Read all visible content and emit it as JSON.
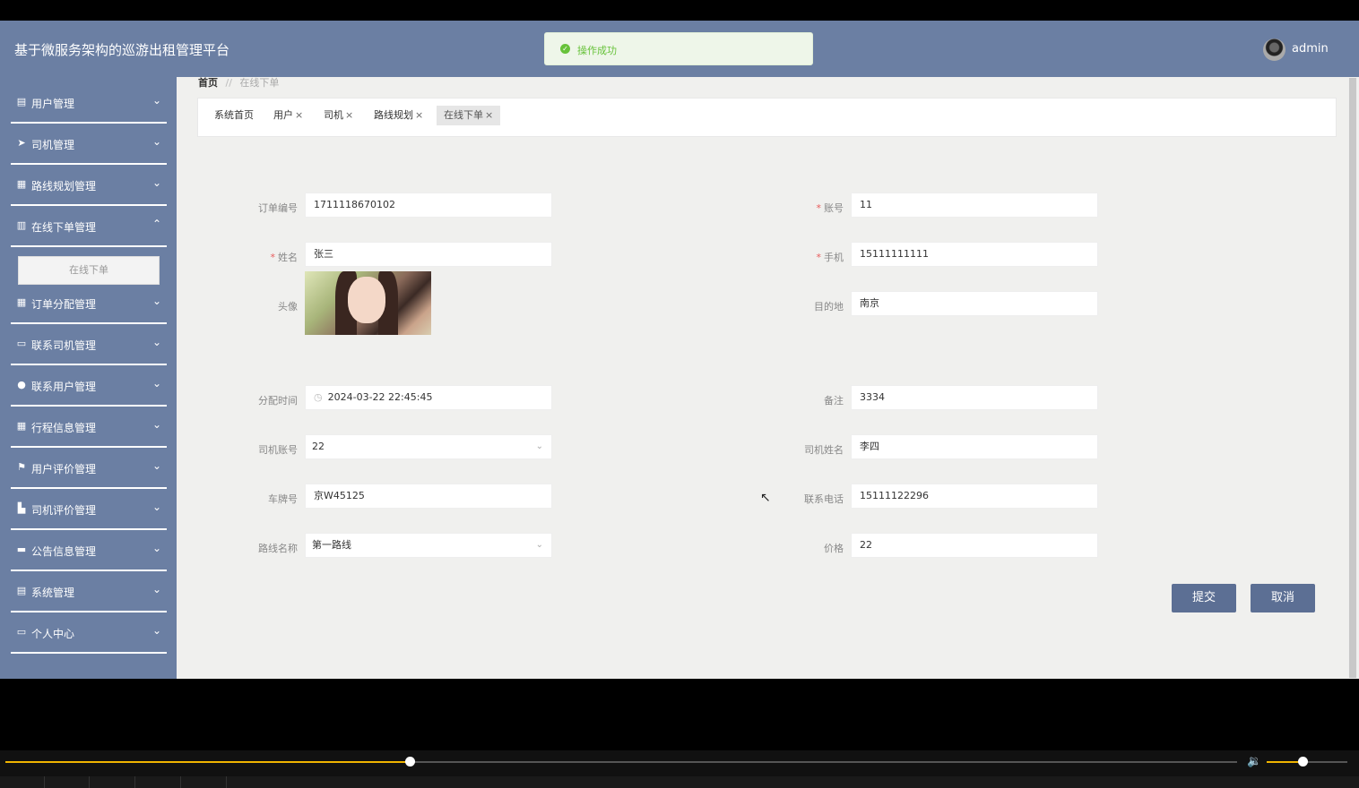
{
  "app": {
    "title": "基于微服务架构的巡游出租管理平台"
  },
  "toast": {
    "message": "操作成功",
    "icon": "check-circle-icon"
  },
  "user": {
    "name": "admin"
  },
  "sidebar": {
    "items": [
      {
        "label": "用户管理",
        "icon": "clipboard-icon"
      },
      {
        "label": "司机管理",
        "icon": "paper-plane-icon"
      },
      {
        "label": "路线规划管理",
        "icon": "grid-icon"
      },
      {
        "label": "在线下单管理",
        "icon": "bar-chart-icon"
      },
      {
        "label": "订单分配管理",
        "icon": "grid-icon"
      },
      {
        "label": "联系司机管理",
        "icon": "monitor-icon"
      },
      {
        "label": "联系用户管理",
        "icon": "bulb-icon"
      },
      {
        "label": "行程信息管理",
        "icon": "grid-icon"
      },
      {
        "label": "用户评价管理",
        "icon": "flag-icon"
      },
      {
        "label": "司机评价管理",
        "icon": "thumbs-up-icon"
      },
      {
        "label": "公告信息管理",
        "icon": "ticket-icon"
      },
      {
        "label": "系统管理",
        "icon": "book-icon"
      },
      {
        "label": "个人中心",
        "icon": "card-icon"
      }
    ],
    "sub_item": "在线下单"
  },
  "breadcrumb": {
    "home": "首页",
    "separator": "//",
    "current": "在线下单"
  },
  "tabs": [
    "系统首页",
    "用户",
    "司机",
    "路线规划",
    "在线下单"
  ],
  "form": {
    "order_no": {
      "label": "订单编号",
      "value": "1711118670102"
    },
    "account": {
      "label": "账号",
      "value": "11"
    },
    "name": {
      "label": "姓名",
      "value": "张三"
    },
    "phone": {
      "label": "手机",
      "value": "15111111111"
    },
    "avatar": {
      "label": "头像"
    },
    "destination": {
      "label": "目的地",
      "value": "南京"
    },
    "assign_time": {
      "label": "分配时间",
      "value": "2024-03-22 22:45:45"
    },
    "remark": {
      "label": "备注",
      "value": "3334"
    },
    "driver_account": {
      "label": "司机账号",
      "value": "22"
    },
    "driver_name": {
      "label": "司机姓名",
      "value": "李四"
    },
    "plate": {
      "label": "车牌号",
      "value": "京W45125"
    },
    "contact_phone": {
      "label": "联系电话",
      "value": "15111122296"
    },
    "route_name": {
      "label": "路线名称",
      "value": "第一路线"
    },
    "price": {
      "label": "价格",
      "value": "22"
    },
    "required_mark": "*"
  },
  "buttons": {
    "submit": "提交",
    "cancel": "取消"
  },
  "player": {
    "progress": 0.328,
    "volume": 0.44
  },
  "colors": {
    "header": "#6b7fa3",
    "button": "#5c6f94",
    "progress": "#f0b400",
    "success": "#67c23a"
  }
}
